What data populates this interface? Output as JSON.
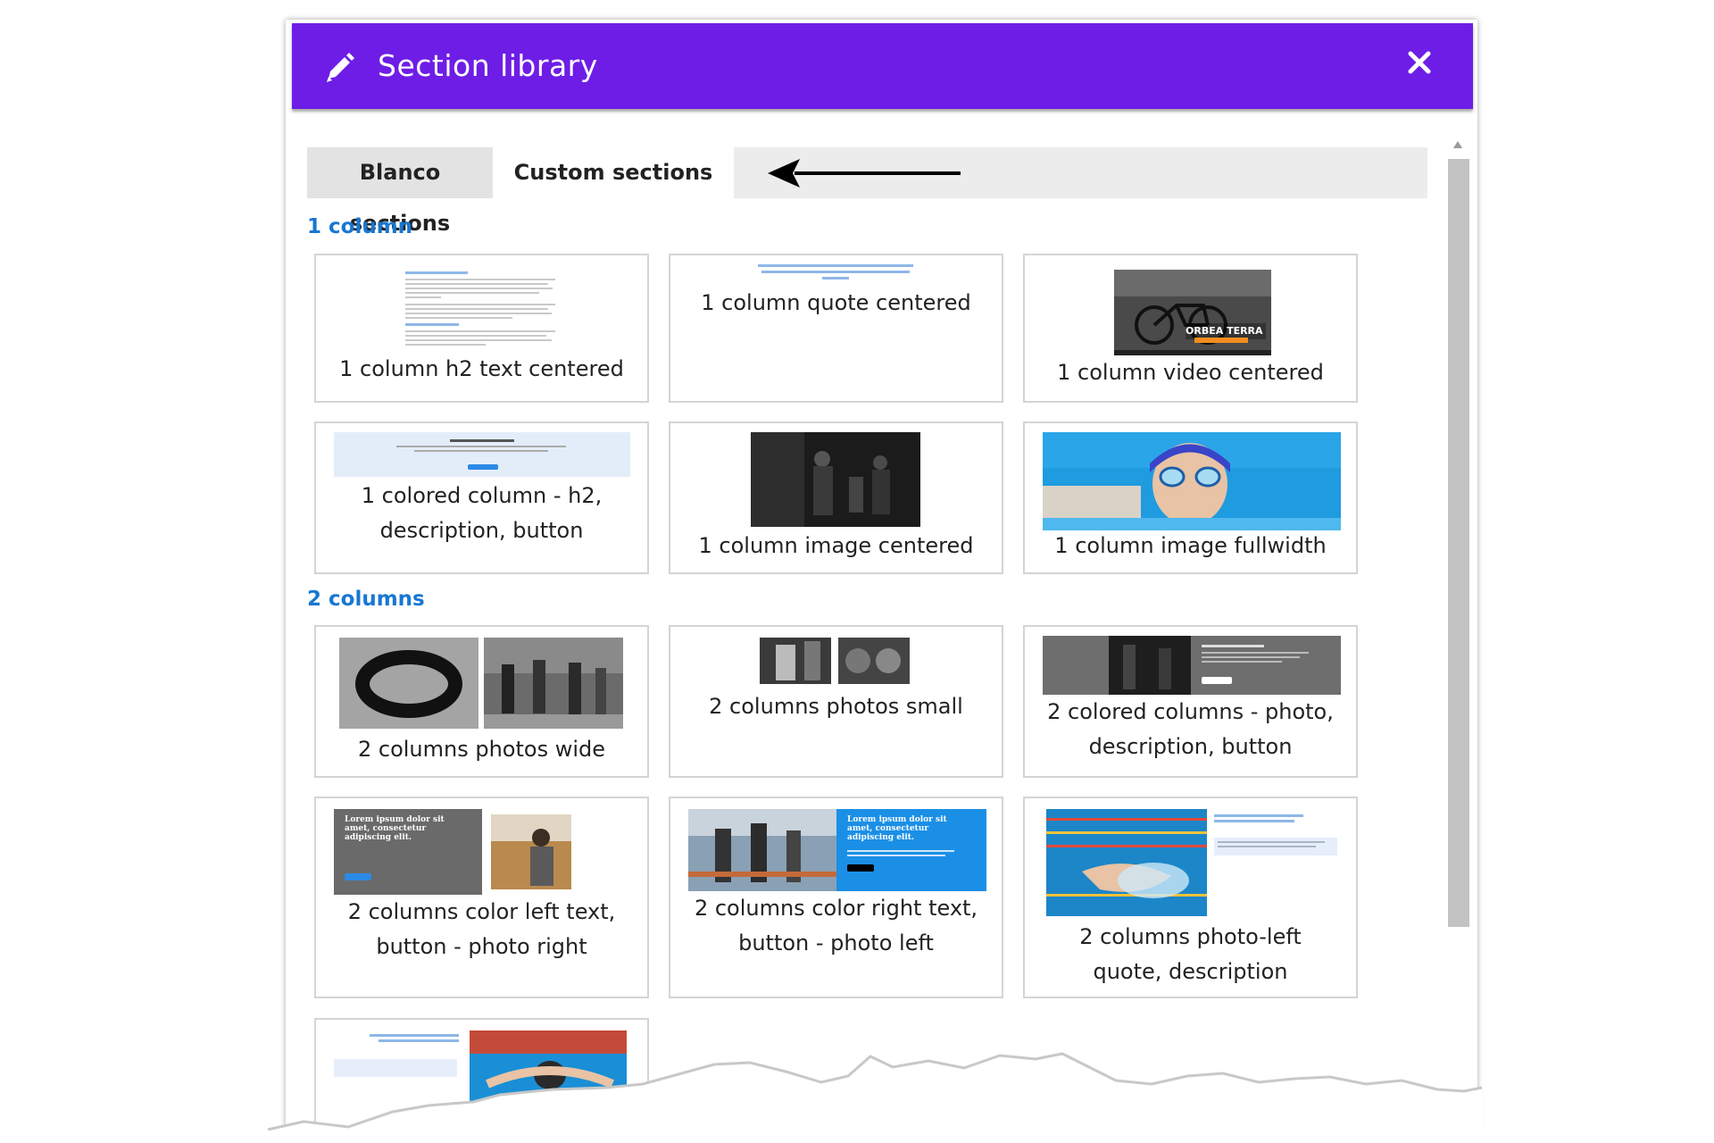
{
  "dialog": {
    "title": "Section library",
    "pencil_icon": "pencil-icon",
    "close_icon": "close-icon"
  },
  "tabs": [
    {
      "label": "Blanco sections"
    },
    {
      "label": "Custom sections"
    }
  ],
  "sections": [
    {
      "heading": "1 column",
      "cards": [
        {
          "label": "1 column h2 text centered"
        },
        {
          "label": "1 column quote centered"
        },
        {
          "label": "1 column video centered",
          "thumb_text": "ORBEA TERRA"
        },
        {
          "label": "1 colored column - h2, description, button"
        },
        {
          "label": "1 column image centered"
        },
        {
          "label": "1 column image fullwidth"
        }
      ]
    },
    {
      "heading": "2 columns",
      "cards": [
        {
          "label": "2 columns photos wide"
        },
        {
          "label": "2 columns photos small"
        },
        {
          "label": "2 colored columns - photo, description, button"
        },
        {
          "label": "2 columns color left text, button - photo right",
          "thumb_text": "Lorem ipsum dolor sit amet, consectetur adipiscing elit."
        },
        {
          "label": "2 columns color right text, button - photo left",
          "thumb_text": "Lorem ipsum dolor sit amet, consectetur adipiscing elit."
        },
        {
          "label": "2 columns photo-left quote, description"
        },
        {
          "label": ""
        }
      ]
    }
  ],
  "colors": {
    "header": "#6e1de6",
    "heading": "#1877d2",
    "hover_label": "#cfcfcf"
  }
}
